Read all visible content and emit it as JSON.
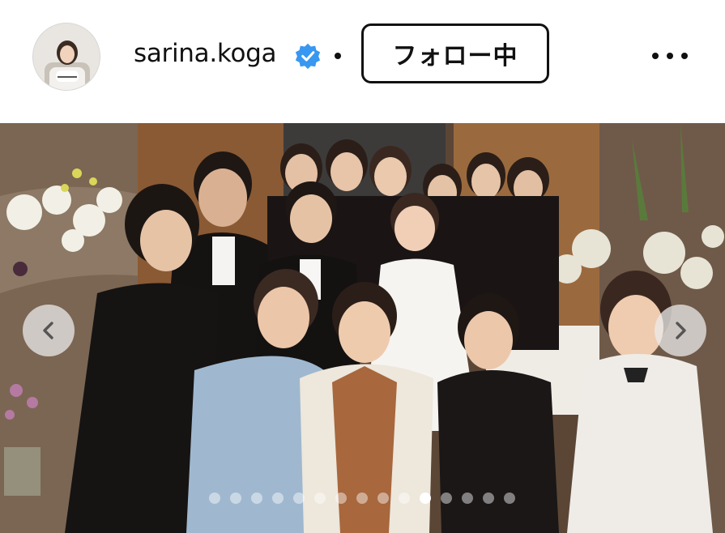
{
  "post_header": {
    "username": "sarina.koga",
    "verified_badge_color": "#3897f0",
    "follow_button_label": "フォロー中",
    "more_icon": "more-horizontal-icon"
  },
  "carousel": {
    "total_slides": 15,
    "active_index": 10,
    "prev_icon": "chevron-left-icon",
    "next_icon": "chevron-right-icon",
    "description_colors": {
      "dot_active": "#ffffff",
      "dot_inactive": "#ffffffaa"
    }
  }
}
